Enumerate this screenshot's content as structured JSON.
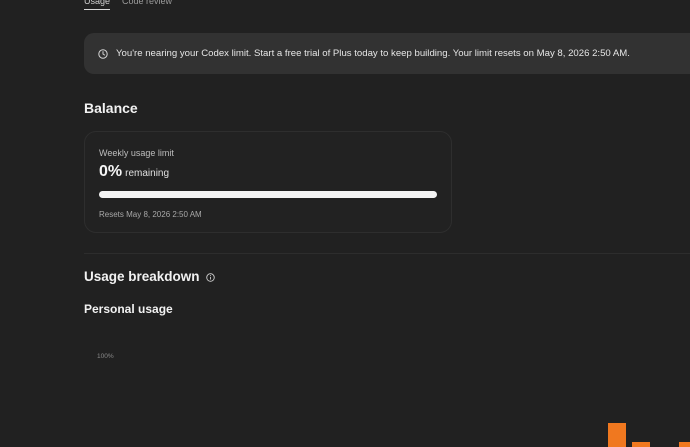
{
  "tabs": [
    {
      "label": "Usage",
      "active": true
    },
    {
      "label": "Code review",
      "active": false
    }
  ],
  "notice": {
    "icon": "clock-icon",
    "text": "You're nearing your Codex limit. Start a free trial of Plus today to keep building. Your limit resets on May 8, 2026 2:50 AM."
  },
  "balance": {
    "heading": "Balance",
    "card": {
      "label": "Weekly usage limit",
      "percent": "0%",
      "remaining_label": "remaining",
      "remaining_fraction": 0,
      "reset_text": "Resets May 8, 2026 2:50 AM"
    }
  },
  "breakdown": {
    "heading": "Usage breakdown",
    "info_icon": "info-icon",
    "personal_heading": "Personal usage",
    "y_axis_top_label": "100%"
  },
  "colors": {
    "bar_accent": "#f0781f",
    "background": "#212121"
  }
}
